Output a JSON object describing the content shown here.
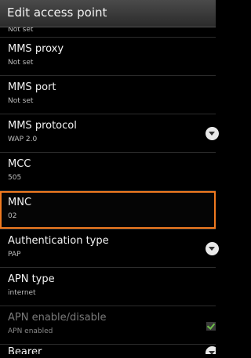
{
  "header": {
    "title": "Edit access point"
  },
  "list": {
    "top_partial_summary": "Not set",
    "items": [
      {
        "label": "MMS proxy",
        "summary": "Not set"
      },
      {
        "label": "MMS port",
        "summary": "Not set"
      },
      {
        "label": "MMS protocol",
        "summary": "WAP 2.0",
        "icon": "dropdown-icon"
      },
      {
        "label": "MCC",
        "summary": "505"
      },
      {
        "label": "MNC",
        "summary": "02",
        "selected": true
      },
      {
        "label": "Authentication type",
        "summary": "PAP",
        "icon": "dropdown-icon"
      },
      {
        "label": "APN type",
        "summary": "internet"
      },
      {
        "label": "APN enable/disable",
        "summary": "APN enabled",
        "enabled": false,
        "icon": "checkbox-icon",
        "checked": true
      }
    ],
    "bottom_partial_label": "Bearer"
  },
  "colors": {
    "selection_outline": "#f07a20",
    "checkbox_check": "#6ec04a"
  }
}
